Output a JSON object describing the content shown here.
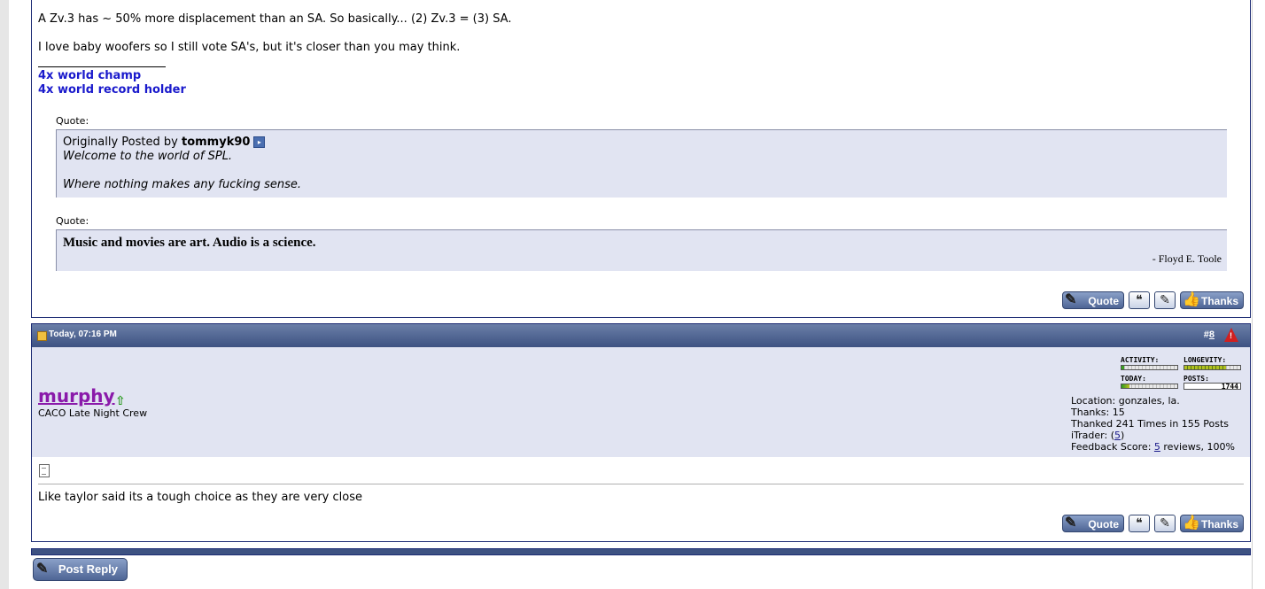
{
  "post1": {
    "line1": "A Zv.3 has ~ 50% more displacement than an SA. So basically... (2) Zv.3 = (3) SA.",
    "line2": "I love baby woofers so I still vote SA's, but it's closer than you may think.",
    "signature": [
      "4x world champ",
      "4x world record holder"
    ],
    "quote1": {
      "label": "Quote:",
      "posted_by_prefix": "Originally Posted by",
      "author": "tommyk90",
      "lines": [
        "Welcome to the world of SPL.",
        "Where nothing makes any fucking sense."
      ]
    },
    "quote2": {
      "label": "Quote:",
      "text": "Music and movies are art. Audio is a science.",
      "attribution": "- Floyd E. Toole"
    }
  },
  "buttons": {
    "quote": "Quote",
    "thanks": "Thanks"
  },
  "post2": {
    "date": "Today, 07:16 PM",
    "number_prefix": "#",
    "number": "8",
    "username": "murphy",
    "user_title": "CACO Late Night Crew",
    "stats": {
      "activity_label": "ACTIVITY:",
      "longevity_label": "LONGEVITY:",
      "today_label": "TODAY:",
      "posts_label": "POSTS:",
      "posts_value": "1744",
      "activity_level": 0.05,
      "longevity_level": 0.75,
      "today_level": 0.15
    },
    "info": {
      "location": "Location: gonzales, la.",
      "thanks": "Thanks: 15",
      "thanked": "Thanked 241 Times in 155 Posts",
      "itrader_prefix": "iTrader: (",
      "itrader_count": "5",
      "itrader_suffix": ")",
      "feedback_prefix": "Feedback Score: ",
      "feedback_count": "5",
      "feedback_suffix": " reviews, 100%"
    },
    "message": "Like taylor said its a tough choice as they are very close"
  },
  "post_reply_label": "Post Reply",
  "colors": {
    "header": "#3d5282",
    "quote_bg": "#e1e4f2",
    "username": "#8a1aaa",
    "signature": "#1a1acc"
  },
  "icons": [
    "arrow-right-icon",
    "page-icon",
    "warning-icon",
    "online-status-icon",
    "document-icon",
    "multi-quote-icon",
    "quick-reply-icon"
  ]
}
